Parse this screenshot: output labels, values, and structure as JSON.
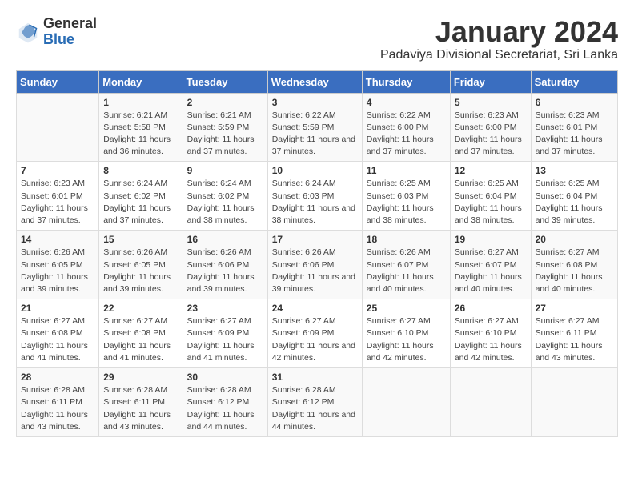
{
  "header": {
    "logo_general": "General",
    "logo_blue": "Blue",
    "main_title": "January 2024",
    "subtitle": "Padaviya Divisional Secretariat, Sri Lanka"
  },
  "columns": [
    "Sunday",
    "Monday",
    "Tuesday",
    "Wednesday",
    "Thursday",
    "Friday",
    "Saturday"
  ],
  "weeks": [
    [
      {
        "day": "",
        "info": ""
      },
      {
        "day": "1",
        "info": "Sunrise: 6:21 AM\nSunset: 5:58 PM\nDaylight: 11 hours and 36 minutes."
      },
      {
        "day": "2",
        "info": "Sunrise: 6:21 AM\nSunset: 5:59 PM\nDaylight: 11 hours and 37 minutes."
      },
      {
        "day": "3",
        "info": "Sunrise: 6:22 AM\nSunset: 5:59 PM\nDaylight: 11 hours and 37 minutes."
      },
      {
        "day": "4",
        "info": "Sunrise: 6:22 AM\nSunset: 6:00 PM\nDaylight: 11 hours and 37 minutes."
      },
      {
        "day": "5",
        "info": "Sunrise: 6:23 AM\nSunset: 6:00 PM\nDaylight: 11 hours and 37 minutes."
      },
      {
        "day": "6",
        "info": "Sunrise: 6:23 AM\nSunset: 6:01 PM\nDaylight: 11 hours and 37 minutes."
      }
    ],
    [
      {
        "day": "7",
        "info": "Sunrise: 6:23 AM\nSunset: 6:01 PM\nDaylight: 11 hours and 37 minutes."
      },
      {
        "day": "8",
        "info": "Sunrise: 6:24 AM\nSunset: 6:02 PM\nDaylight: 11 hours and 37 minutes."
      },
      {
        "day": "9",
        "info": "Sunrise: 6:24 AM\nSunset: 6:02 PM\nDaylight: 11 hours and 38 minutes."
      },
      {
        "day": "10",
        "info": "Sunrise: 6:24 AM\nSunset: 6:03 PM\nDaylight: 11 hours and 38 minutes."
      },
      {
        "day": "11",
        "info": "Sunrise: 6:25 AM\nSunset: 6:03 PM\nDaylight: 11 hours and 38 minutes."
      },
      {
        "day": "12",
        "info": "Sunrise: 6:25 AM\nSunset: 6:04 PM\nDaylight: 11 hours and 38 minutes."
      },
      {
        "day": "13",
        "info": "Sunrise: 6:25 AM\nSunset: 6:04 PM\nDaylight: 11 hours and 39 minutes."
      }
    ],
    [
      {
        "day": "14",
        "info": "Sunrise: 6:26 AM\nSunset: 6:05 PM\nDaylight: 11 hours and 39 minutes."
      },
      {
        "day": "15",
        "info": "Sunrise: 6:26 AM\nSunset: 6:05 PM\nDaylight: 11 hours and 39 minutes."
      },
      {
        "day": "16",
        "info": "Sunrise: 6:26 AM\nSunset: 6:06 PM\nDaylight: 11 hours and 39 minutes."
      },
      {
        "day": "17",
        "info": "Sunrise: 6:26 AM\nSunset: 6:06 PM\nDaylight: 11 hours and 39 minutes."
      },
      {
        "day": "18",
        "info": "Sunrise: 6:26 AM\nSunset: 6:07 PM\nDaylight: 11 hours and 40 minutes."
      },
      {
        "day": "19",
        "info": "Sunrise: 6:27 AM\nSunset: 6:07 PM\nDaylight: 11 hours and 40 minutes."
      },
      {
        "day": "20",
        "info": "Sunrise: 6:27 AM\nSunset: 6:08 PM\nDaylight: 11 hours and 40 minutes."
      }
    ],
    [
      {
        "day": "21",
        "info": "Sunrise: 6:27 AM\nSunset: 6:08 PM\nDaylight: 11 hours and 41 minutes."
      },
      {
        "day": "22",
        "info": "Sunrise: 6:27 AM\nSunset: 6:08 PM\nDaylight: 11 hours and 41 minutes."
      },
      {
        "day": "23",
        "info": "Sunrise: 6:27 AM\nSunset: 6:09 PM\nDaylight: 11 hours and 41 minutes."
      },
      {
        "day": "24",
        "info": "Sunrise: 6:27 AM\nSunset: 6:09 PM\nDaylight: 11 hours and 42 minutes."
      },
      {
        "day": "25",
        "info": "Sunrise: 6:27 AM\nSunset: 6:10 PM\nDaylight: 11 hours and 42 minutes."
      },
      {
        "day": "26",
        "info": "Sunrise: 6:27 AM\nSunset: 6:10 PM\nDaylight: 11 hours and 42 minutes."
      },
      {
        "day": "27",
        "info": "Sunrise: 6:27 AM\nSunset: 6:11 PM\nDaylight: 11 hours and 43 minutes."
      }
    ],
    [
      {
        "day": "28",
        "info": "Sunrise: 6:28 AM\nSunset: 6:11 PM\nDaylight: 11 hours and 43 minutes."
      },
      {
        "day": "29",
        "info": "Sunrise: 6:28 AM\nSunset: 6:11 PM\nDaylight: 11 hours and 43 minutes."
      },
      {
        "day": "30",
        "info": "Sunrise: 6:28 AM\nSunset: 6:12 PM\nDaylight: 11 hours and 44 minutes."
      },
      {
        "day": "31",
        "info": "Sunrise: 6:28 AM\nSunset: 6:12 PM\nDaylight: 11 hours and 44 minutes."
      },
      {
        "day": "",
        "info": ""
      },
      {
        "day": "",
        "info": ""
      },
      {
        "day": "",
        "info": ""
      }
    ]
  ]
}
